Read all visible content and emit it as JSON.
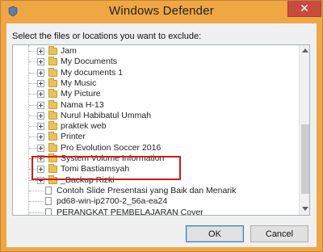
{
  "window": {
    "title": "Windows Defender",
    "close_label": "✕",
    "accent_color": "#efa744"
  },
  "instruction": "Select the files or locations you want to exclude:",
  "tree": {
    "items": [
      {
        "label": "Jam",
        "type": "folder",
        "icon": "folder-icon"
      },
      {
        "label": "My Documents",
        "type": "folder",
        "icon": "folder-icon"
      },
      {
        "label": "My documents 1",
        "type": "folder",
        "icon": "folder-icon"
      },
      {
        "label": "My Music",
        "type": "folder",
        "icon": "folder-icon"
      },
      {
        "label": "My Picture",
        "type": "folder",
        "icon": "folder-icon"
      },
      {
        "label": "Nama H-13",
        "type": "folder",
        "icon": "folder-icon"
      },
      {
        "label": "Nurul Habibatul Ummah",
        "type": "folder",
        "icon": "folder-icon"
      },
      {
        "label": "praktek web",
        "type": "folder",
        "icon": "folder-icon"
      },
      {
        "label": "Printer",
        "type": "folder",
        "icon": "folder-icon"
      },
      {
        "label": "Pro Evolution Soccer 2016",
        "type": "folder",
        "icon": "folder-icon"
      },
      {
        "label": "System Volume Information",
        "type": "folder",
        "icon": "folder-icon"
      },
      {
        "label": "Tomi Bastiamsyah",
        "type": "folder",
        "icon": "folder-icon"
      },
      {
        "label": "_Backup Rizki",
        "type": "folder",
        "icon": "folder-icon"
      },
      {
        "label": "Contoh Slide Presentasi yang Baik dan Menarik",
        "type": "file",
        "icon": "file-icon"
      },
      {
        "label": "pd68-win-ip2700-2_56a-ea24",
        "type": "file",
        "icon": "file-icon"
      },
      {
        "label": "PERANGKAT PEMBELAJARAN Cover",
        "type": "file",
        "icon": "file-icon"
      }
    ],
    "highlighted_item": "Pro Evolution Soccer 2016",
    "highlight_color": "#d11a1a"
  },
  "buttons": {
    "ok": "OK",
    "cancel": "Cancel"
  }
}
